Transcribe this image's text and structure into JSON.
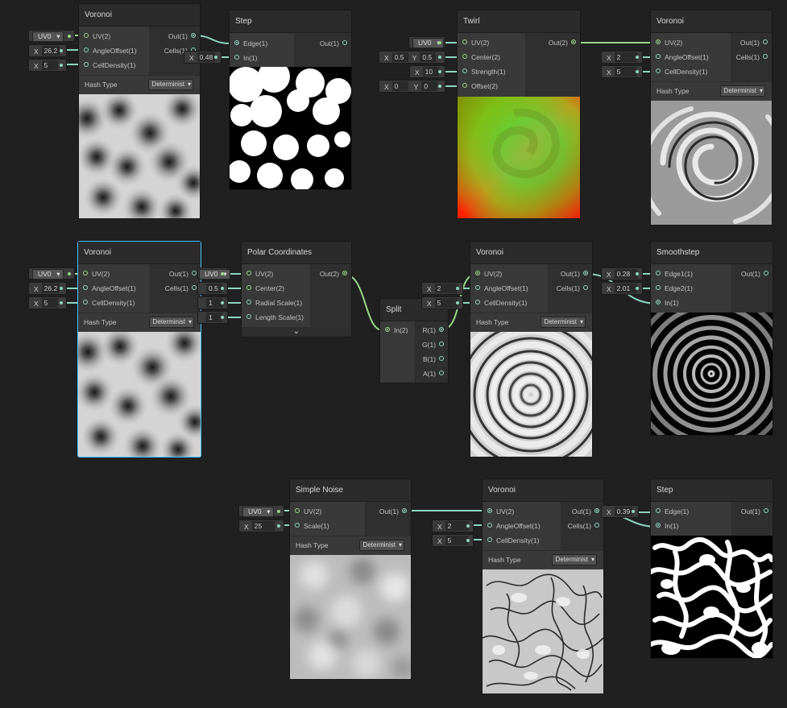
{
  "hash_label": "Hash Type",
  "hash_value": "Deterministic",
  "hash_short": "Determinist",
  "uv_label": "UV0",
  "nodes": {
    "voronoi1": {
      "title": "Voronoi",
      "in": [
        "UV(2)",
        "AngleOffset(1)",
        "CellDensity(1)"
      ],
      "out": [
        "Out(1)",
        "Cells(1)"
      ],
      "angle": "26.2",
      "density": "5"
    },
    "step1": {
      "title": "Step",
      "in": [
        "Edge(1)",
        "In(1)"
      ],
      "out": [
        "Out(1)"
      ],
      "edge": "0.48"
    },
    "twirl": {
      "title": "Twirl",
      "in": [
        "UV(2)",
        "Center(2)",
        "Strength(1)",
        "Offset(2)"
      ],
      "out": [
        "Out(2)"
      ],
      "center_x": "0.5",
      "center_y": "0.5",
      "strength": "10",
      "offset_x": "0",
      "offset_y": "0"
    },
    "voronoi2": {
      "title": "Voronoi",
      "in": [
        "UV(2)",
        "AngleOffset(1)",
        "CellDensity(1)"
      ],
      "out": [
        "Out(1)",
        "Cells(1)"
      ],
      "angle": "2",
      "density": "5"
    },
    "voronoi3": {
      "title": "Voronoi",
      "in": [
        "UV(2)",
        "AngleOffset(1)",
        "CellDensity(1)"
      ],
      "out": [
        "Out(1)",
        "Cells(1)"
      ],
      "angle": "26.2",
      "density": "5"
    },
    "polar": {
      "title": "Polar Coordinates",
      "in": [
        "UV(2)",
        "Center(2)",
        "Radial Scale(1)",
        "Length Scale(1)"
      ],
      "out": [
        "Out(2)"
      ],
      "center": "0.5",
      "radial": "1",
      "length": "1"
    },
    "split": {
      "title": "Split",
      "in": [
        "In(2)"
      ],
      "out": [
        "R(1)",
        "G(1)",
        "B(1)",
        "A(1)"
      ]
    },
    "voronoi4": {
      "title": "Voronoi",
      "in": [
        "UV(2)",
        "AngleOffset(1)",
        "CellDensity(1)"
      ],
      "out": [
        "Out(1)",
        "Cells(1)"
      ],
      "angle": "2",
      "density": "5"
    },
    "smoothstep": {
      "title": "Smoothstep",
      "in": [
        "Edge1(1)",
        "Edge2(1)",
        "In(1)"
      ],
      "out": [
        "Out(1)"
      ],
      "edge1": "0.28",
      "edge2": "2.01"
    },
    "noise": {
      "title": "Simple Noise",
      "in": [
        "UV(2)",
        "Scale(1)"
      ],
      "out": [
        "Out(1)"
      ],
      "scale": "25"
    },
    "voronoi5": {
      "title": "Voronoi",
      "in": [
        "UV(2)",
        "AngleOffset(1)",
        "CellDensity(1)"
      ],
      "out": [
        "Out(1)",
        "Cells(1)"
      ],
      "angle": "2",
      "density": "5"
    },
    "step2": {
      "title": "Step",
      "in": [
        "Edge(1)",
        "In(1)"
      ],
      "out": [
        "Out(1)"
      ],
      "edge": "0.39"
    }
  },
  "axis": {
    "x": "X",
    "y": "Y"
  },
  "colors": {
    "canvas": "#202020",
    "node": "#393939",
    "header": "#2b2b2b",
    "wire_float": "#8fd3c2",
    "wire_vec2": "#9bd68a",
    "selection": "#44c0ff"
  }
}
